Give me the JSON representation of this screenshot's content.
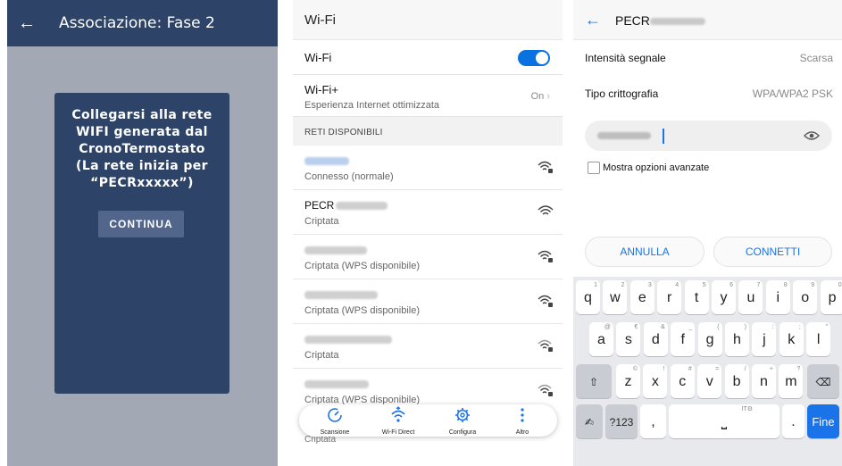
{
  "panel1": {
    "title": "Associazione: Fase 2",
    "message": "Collegarsi alla rete\nWIFI generata dal\nCronoTermostato\n(La rete inizia per\n“PECRxxxxx”)",
    "continue_label": "CONTINUA"
  },
  "panel2": {
    "header": "Wi-Fi",
    "wifi_label": "Wi-Fi",
    "wifi_plus_label": "Wi-Fi+",
    "wifi_plus_sub": "Esperienza Internet ottimizzata",
    "wifi_plus_value": "On",
    "section_label": "RETI DISPONIBILI",
    "networks": [
      {
        "ssid": "",
        "status": "Connesso (normale)"
      },
      {
        "ssid": "PECR",
        "status": "Criptata"
      },
      {
        "ssid": "",
        "status": "Criptata (WPS disponibile)"
      },
      {
        "ssid": "",
        "status": "Criptata (WPS disponibile)"
      },
      {
        "ssid": "",
        "status": "Criptata"
      },
      {
        "ssid": "",
        "status": "Criptata (WPS disponibile)"
      }
    ],
    "bottom_bar": [
      {
        "label": "Scansione"
      },
      {
        "label": "Wi-Fi Direct"
      },
      {
        "label": "Configura"
      },
      {
        "label": "Altro"
      }
    ],
    "under_bar_text": "Criptata"
  },
  "panel3": {
    "title": "PECR",
    "signal_label": "Intensità segnale",
    "signal_value": "Scarsa",
    "encryption_label": "Tipo crittografia",
    "encryption_value": "WPA/WPA2 PSK",
    "advanced_label": "Mostra opzioni avanzate",
    "cancel_label": "ANNULLA",
    "connect_label": "CONNETTI",
    "keyboard": {
      "row1": [
        {
          "k": "q",
          "s": "1"
        },
        {
          "k": "w",
          "s": "2"
        },
        {
          "k": "e",
          "s": "3"
        },
        {
          "k": "r",
          "s": "4"
        },
        {
          "k": "t",
          "s": "5"
        },
        {
          "k": "y",
          "s": "6"
        },
        {
          "k": "u",
          "s": "7"
        },
        {
          "k": "i",
          "s": "8"
        },
        {
          "k": "o",
          "s": "9"
        },
        {
          "k": "p",
          "s": "0"
        }
      ],
      "row2": [
        {
          "k": "a",
          "s": "@"
        },
        {
          "k": "s",
          "s": "€"
        },
        {
          "k": "d",
          "s": "&"
        },
        {
          "k": "f",
          "s": "_"
        },
        {
          "k": "g",
          "s": "("
        },
        {
          "k": "h",
          "s": ")"
        },
        {
          "k": "j",
          "s": ":"
        },
        {
          "k": "k",
          "s": ";"
        },
        {
          "k": "l",
          "s": "\""
        }
      ],
      "row3": [
        {
          "k": "z",
          "s": "©"
        },
        {
          "k": "x",
          "s": "!"
        },
        {
          "k": "c",
          "s": "#"
        },
        {
          "k": "v",
          "s": "="
        },
        {
          "k": "b",
          "s": "/"
        },
        {
          "k": "n",
          "s": "+"
        },
        {
          "k": "m",
          "s": "?"
        }
      ],
      "num_label": "?123",
      "comma": ",",
      "space_hint": "IT⚙",
      "period": ".",
      "done_label": "Fine"
    }
  },
  "colors": {
    "navy": "#2d4368",
    "gray_bg": "#a3a8b5",
    "accent_blue": "#1a73e8"
  }
}
